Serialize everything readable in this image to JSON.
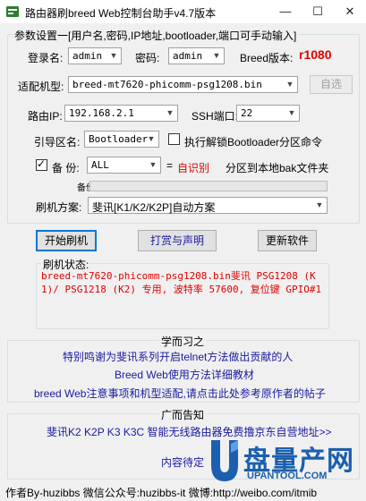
{
  "window": {
    "title": "路由器刷breed Web控制台助手v4.7版本",
    "minimize": "—",
    "maximize": "☐",
    "close": "✕"
  },
  "params": {
    "group_title": "参数设置一[用户名,密码,IP地址,bootloader,端口可手动输入]",
    "login_label": "登录名:",
    "login_value": "admin",
    "password_label": "密码:",
    "password_value": "admin",
    "breed_version_label": "Breed版本:",
    "breed_version_value": "r1080",
    "model_label": "适配机型:",
    "model_value": "breed-mt7620-phicomm-psg1208.bin",
    "auto_select_button": "自选",
    "router_ip_label": "路由IP:",
    "router_ip_value": "192.168.2.1",
    "ssh_port_label": "SSH端口:",
    "ssh_port_value": "22",
    "boot_area_label": "引导区名:",
    "boot_area_value": "Bootloader",
    "unlock_checkbox_label": "执行解锁Bootloader分区命令",
    "unlock_checked": false,
    "backup_label": "备 份:",
    "backup_checked": true,
    "backup_value": "ALL",
    "backup_eq": "=",
    "backup_auto": "自识别",
    "backup_desc": "分区到本地bak文件夹",
    "progress_label": "备份进度:",
    "progress_fraction": 0.0,
    "flash_plan_label": "刷机方案:",
    "flash_plan_value": "斐讯[K1/K2/K2P]自动方案"
  },
  "actions": {
    "start": "开始刷机",
    "donate": "打赏与声明",
    "update": "更新软件"
  },
  "status": {
    "label": "刷机状态:",
    "text": "breed-mt7620-phicomm-psg1208.bin斐讯 PSG1208 (K1)/ PSG1218 (K2) 专用, 波特率 57600, 复位键 GPIO#1"
  },
  "learn": {
    "title": "学而习之",
    "link1": "特别鸣谢为斐讯系列开启telnet方法做出贡献的人",
    "link2": "Breed Web使用方法详细教材",
    "link3": "breed Web注意事项和机型适配,请点击此处参考原作者的帖子"
  },
  "ads": {
    "title": "广而告知",
    "link1": "斐讯K2 K2P K3 K3C 智能无线路由器免费撸京东自营地址>>",
    "pending": "内容待定"
  },
  "footer": {
    "text": "作者By-huzibbs 微信公众号:huzibbs-it 微博:http://weibo.com/itmib"
  },
  "watermark": {
    "brand": "盘量产网",
    "url": "UPANTOOL.COM"
  },
  "colors": {
    "accent_red": "#e00000",
    "link_blue": "#1a1aa0",
    "brand_blue": "#1c5fae"
  }
}
